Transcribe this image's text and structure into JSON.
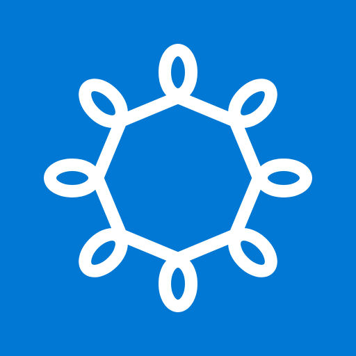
{
  "icon": {
    "name": "octagon-loops-logo",
    "background_color": "#0078D4",
    "stroke_color": "#FFFFFF"
  }
}
